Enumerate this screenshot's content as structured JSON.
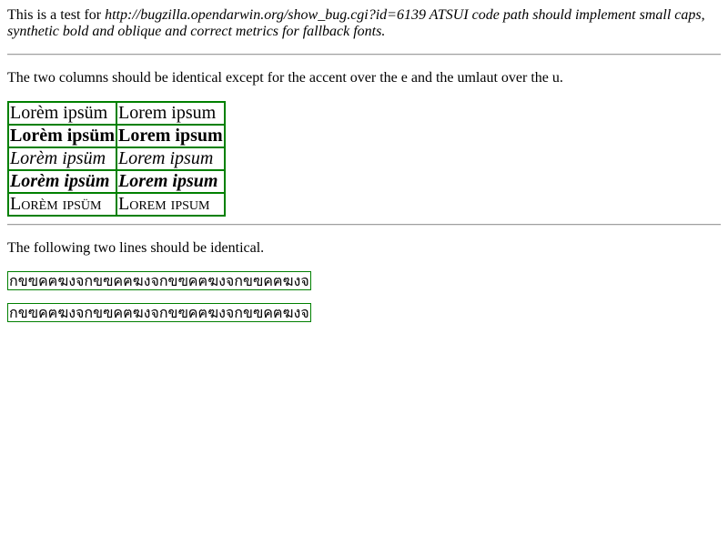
{
  "intro": {
    "prefix": "This is a test for ",
    "italic": "http://bugzilla.opendarwin.org/show_bug.cgi?id=6139 ATSUI code path should implement small caps, synthetic bold and oblique and correct metrics for fallback fonts."
  },
  "instructions_columns": "The two columns should be identical except for the accent over the e and the umlaut over the u.",
  "table": {
    "rows": [
      {
        "style": "normal",
        "left": "Lorèm ipsüm",
        "right": "Lorem ipsum"
      },
      {
        "style": "bold",
        "left": "Lorèm ipsüm",
        "right": "Lorem ipsum"
      },
      {
        "style": "italic",
        "left": "Lorèm ipsüm",
        "right": "Lorem ipsum"
      },
      {
        "style": "bold-italic",
        "left": "Lorèm ipsüm",
        "right": "Lorem ipsum"
      },
      {
        "style": "small-caps",
        "left": "Lorèm ipsüm",
        "right": "Lorem ipsum"
      }
    ]
  },
  "instructions_lines": "The following two lines should be identical.",
  "thai_lines": [
    "กขฃคฅฆงจกขฃคฅฆงจกขฃคฅฆงจกขฃคฅฆงจ",
    "กขฃคฅฆงจกขฃคฅฆงจกขฃคฅฆงจกขฃคฅฆงจ"
  ],
  "colors": {
    "border": "#008000",
    "rule": "#a0a0a0"
  }
}
